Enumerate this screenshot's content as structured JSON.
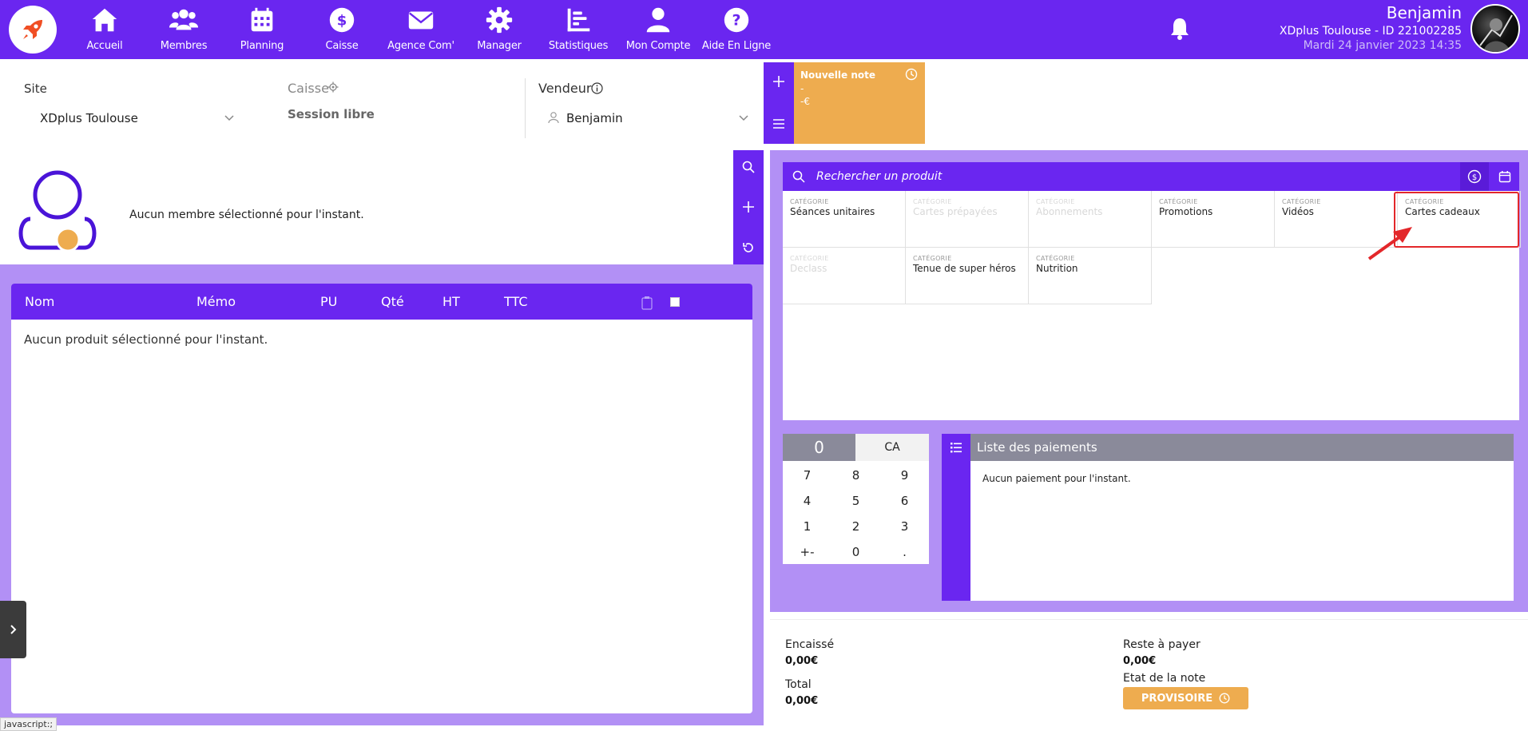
{
  "nav": {
    "items": [
      {
        "label": "Accueil",
        "icon": "home-icon"
      },
      {
        "label": "Membres",
        "icon": "members-icon"
      },
      {
        "label": "Planning",
        "icon": "calendar-icon"
      },
      {
        "label": "Caisse",
        "icon": "dollar-icon"
      },
      {
        "label": "Agence Com'",
        "icon": "envelope-icon"
      },
      {
        "label": "Manager",
        "icon": "gear-icon"
      },
      {
        "label": "Statistiques",
        "icon": "chart-icon"
      },
      {
        "label": "Mon Compte",
        "icon": "user-icon"
      },
      {
        "label": "Aide En Ligne",
        "icon": "help-icon"
      }
    ]
  },
  "user": {
    "name": "Benjamin",
    "org": "XDplus Toulouse - ID 221002285",
    "date": "Mardi 24 janvier 2023 14:35"
  },
  "filters": {
    "site_label": "Site",
    "site_value": "XDplus Toulouse",
    "caisse_label": "Caisse",
    "caisse_value": "Session libre",
    "vendeur_label": "Vendeur",
    "vendeur_value": "Benjamin"
  },
  "note": {
    "title": "Nouvelle note",
    "line1": "-",
    "line2": "-€"
  },
  "member": {
    "empty_text": "Aucun membre sélectionné pour l'instant."
  },
  "products": {
    "headers": {
      "nom": "Nom",
      "memo": "Mémo",
      "pu": "PU",
      "qte": "Qté",
      "ht": "HT",
      "ttc": "TTC"
    },
    "empty_text": "Aucun produit sélectionné pour l'instant."
  },
  "catalog": {
    "search_placeholder": "Rechercher un produit",
    "category_kicker": "CATÉGORIE",
    "categories": [
      {
        "label": "Séances unitaires",
        "enabled": true
      },
      {
        "label": "Cartes prépayées",
        "enabled": false
      },
      {
        "label": "Abonnements",
        "enabled": false
      },
      {
        "label": "Promotions",
        "enabled": true
      },
      {
        "label": "Vidéos",
        "enabled": true
      },
      {
        "label": "Cartes cadeaux",
        "enabled": true
      },
      {
        "label": "Declass",
        "enabled": false
      },
      {
        "label": "Tenue de super héros",
        "enabled": true
      },
      {
        "label": "Nutrition",
        "enabled": true
      }
    ]
  },
  "keypad": {
    "display": "0",
    "ca": "CA",
    "keys": [
      "7",
      "8",
      "9",
      "4",
      "5",
      "6",
      "1",
      "2",
      "3",
      "+-",
      "0",
      "."
    ]
  },
  "payments": {
    "title": "Liste des paiements",
    "empty_text": "Aucun paiement pour l'instant."
  },
  "summary": {
    "encaisse_label": "Encaissé",
    "encaisse_value": "0,00€",
    "total_label": "Total",
    "total_value": "0,00€",
    "reste_label": "Reste à payer",
    "reste_value": "0,00€",
    "etat_label": "Etat de la note",
    "etat_button": "PROVISOIRE"
  },
  "status_url": "javascript:;",
  "colors": {
    "primary": "#6a26f0",
    "panel_bg": "#b290f5",
    "accent": "#eeac4f",
    "highlight": "#e3272a",
    "grey_header": "#8a8a9a"
  }
}
